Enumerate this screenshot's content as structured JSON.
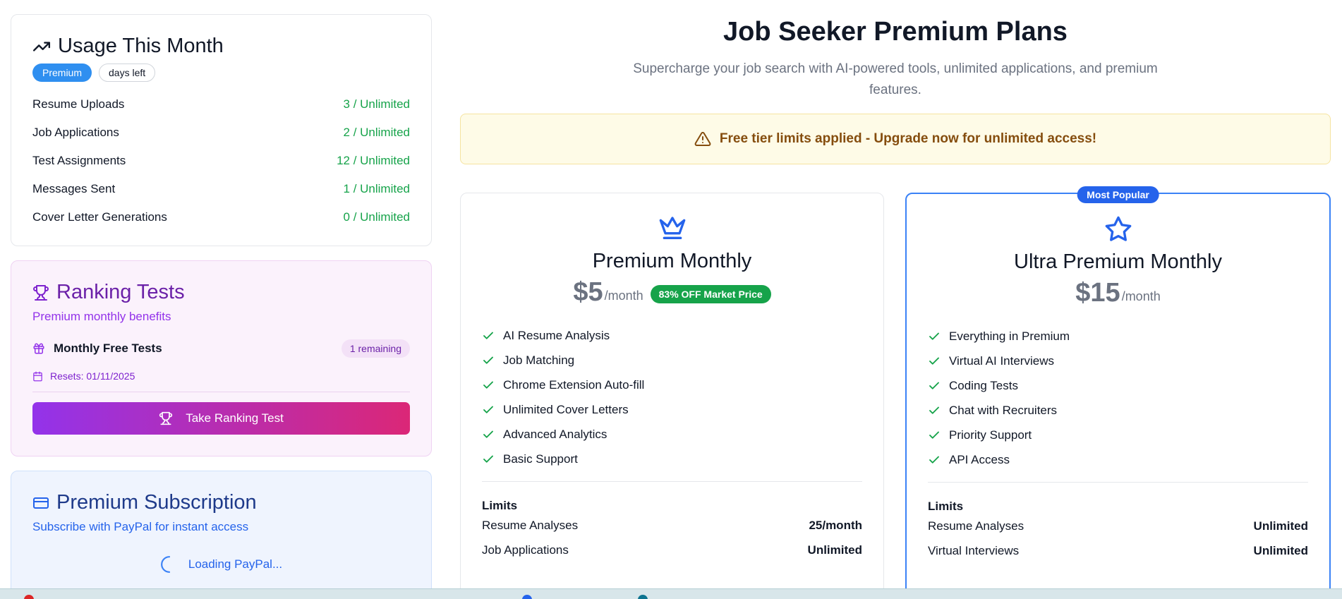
{
  "usage": {
    "title": "Usage This Month",
    "plan_badge": "Premium",
    "days_badge": "days left",
    "rows": [
      {
        "label": "Resume Uploads",
        "value": "3 / Unlimited"
      },
      {
        "label": "Job Applications",
        "value": "2 / Unlimited"
      },
      {
        "label": "Test Assignments",
        "value": "12 / Unlimited"
      },
      {
        "label": "Messages Sent",
        "value": "1 / Unlimited"
      },
      {
        "label": "Cover Letter Generations",
        "value": "0 / Unlimited"
      }
    ]
  },
  "ranking": {
    "title": "Ranking Tests",
    "subtitle": "Premium monthly benefits",
    "free_tests_label": "Monthly Free Tests",
    "remaining": "1 remaining",
    "resets": "Resets: 01/11/2025",
    "button_label": "Take Ranking Test"
  },
  "subscription": {
    "title": "Premium Subscription",
    "subtitle": "Subscribe with PayPal for instant access",
    "loading": "Loading PayPal..."
  },
  "header": {
    "title": "Job Seeker Premium Plans",
    "subtitle": "Supercharge your job search with AI-powered tools, unlimited applications, and premium features."
  },
  "alert": {
    "text": "Free tier limits applied - Upgrade now for unlimited access!"
  },
  "plans": [
    {
      "name": "Premium Monthly",
      "price": "$5",
      "per": "/month",
      "discount": "83% OFF Market Price",
      "features": [
        "AI Resume Analysis",
        "Job Matching",
        "Chrome Extension Auto-fill",
        "Unlimited Cover Letters",
        "Advanced Analytics",
        "Basic Support"
      ],
      "limits_title": "Limits",
      "limits": [
        {
          "label": "Resume Analyses",
          "value": "25/month"
        },
        {
          "label": "Job Applications",
          "value": "Unlimited"
        }
      ]
    },
    {
      "name": "Ultra Premium Monthly",
      "badge": "Most Popular",
      "price": "$15",
      "per": "/month",
      "features": [
        "Everything in Premium",
        "Virtual AI Interviews",
        "Coding Tests",
        "Chat with Recruiters",
        "Priority Support",
        "API Access"
      ],
      "limits_title": "Limits",
      "limits": [
        {
          "label": "Resume Analyses",
          "value": "Unlimited"
        },
        {
          "label": "Virtual Interviews",
          "value": "Unlimited"
        }
      ]
    }
  ],
  "colors": {
    "accent": "#2563eb",
    "success": "#16a34a",
    "ranking_purple": "#6b21a8",
    "alert_text": "#854d0e"
  }
}
